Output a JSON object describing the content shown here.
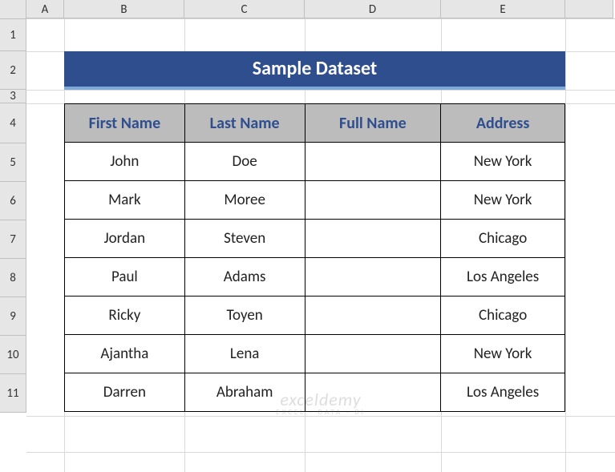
{
  "columns": [
    "A",
    "B",
    "C",
    "D",
    "E"
  ],
  "rows": [
    "1",
    "2",
    "3",
    "4",
    "5",
    "6",
    "7",
    "8",
    "9",
    "10",
    "11"
  ],
  "title": "Sample Dataset",
  "headers": {
    "first_name": "First Name",
    "last_name": "Last Name",
    "full_name": "Full Name",
    "address": "Address"
  },
  "data": [
    {
      "first": "John",
      "last": "Doe",
      "full": "",
      "address": "New York"
    },
    {
      "first": "Mark",
      "last": "Moree",
      "full": "",
      "address": "New York"
    },
    {
      "first": "Jordan",
      "last": "Steven",
      "full": "",
      "address": "Chicago"
    },
    {
      "first": "Paul",
      "last": "Adams",
      "full": "",
      "address": "Los Angeles"
    },
    {
      "first": "Ricky",
      "last": "Toyen",
      "full": "",
      "address": "Chicago"
    },
    {
      "first": "Ajantha",
      "last": "Lena",
      "full": "",
      "address": "New York"
    },
    {
      "first": "Darren",
      "last": "Abraham",
      "full": "",
      "address": "Los Angeles"
    }
  ],
  "watermark": {
    "main": "exceldemy",
    "sub": "EXCEL · DATA · BI"
  },
  "chart_data": {
    "type": "table",
    "title": "Sample Dataset",
    "columns": [
      "First Name",
      "Last Name",
      "Full Name",
      "Address"
    ],
    "rows": [
      [
        "John",
        "Doe",
        "",
        "New York"
      ],
      [
        "Mark",
        "Moree",
        "",
        "New York"
      ],
      [
        "Jordan",
        "Steven",
        "",
        "Chicago"
      ],
      [
        "Paul",
        "Adams",
        "",
        "Los Angeles"
      ],
      [
        "Ricky",
        "Toyen",
        "",
        "Chicago"
      ],
      [
        "Ajantha",
        "Lena",
        "",
        "New York"
      ],
      [
        "Darren",
        "Abraham",
        "",
        "Los Angeles"
      ]
    ]
  }
}
